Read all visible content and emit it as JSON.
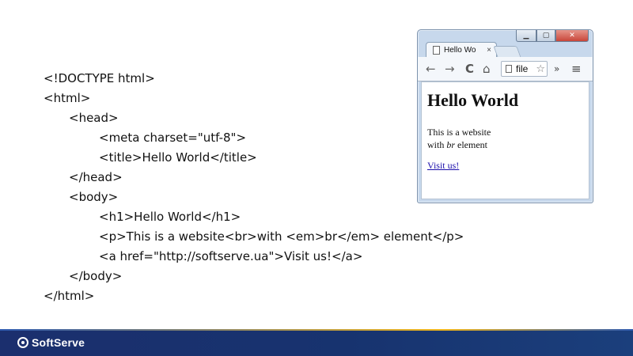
{
  "code_lines": [
    "<!DOCTYPE html>",
    "<html>",
    "<head>",
    "<meta charset=\"utf-8\">",
    "<title>Hello World</title>",
    "</head>",
    "<body>",
    "<h1>Hello World</h1>",
    "<p>This is a website<br>with <em>br</em> element</p>",
    "<a href=\"http://softserve.ua\">Visit us!</a>",
    "</body>",
    "</html>"
  ],
  "browser": {
    "tab_title": "Hello Wo",
    "tab_close": "×",
    "window_controls": {
      "minimize": "▁",
      "maximize": "▢",
      "close": "✕"
    },
    "toolbar": {
      "back": "←",
      "forward": "→",
      "reload": "C",
      "home": "⌂",
      "address": "file",
      "star": "☆",
      "overflow": "»",
      "menu": "≡"
    },
    "page": {
      "heading": "Hello World",
      "text_line1": "This is a website",
      "text_line2_prefix": "with ",
      "text_em": "br",
      "text_line2_suffix": " element",
      "link": "Visit us!"
    }
  },
  "footer": {
    "logo_text": "SoftServe",
    "accent_colors": [
      "#1b2f6e",
      "#f0b51a"
    ]
  }
}
